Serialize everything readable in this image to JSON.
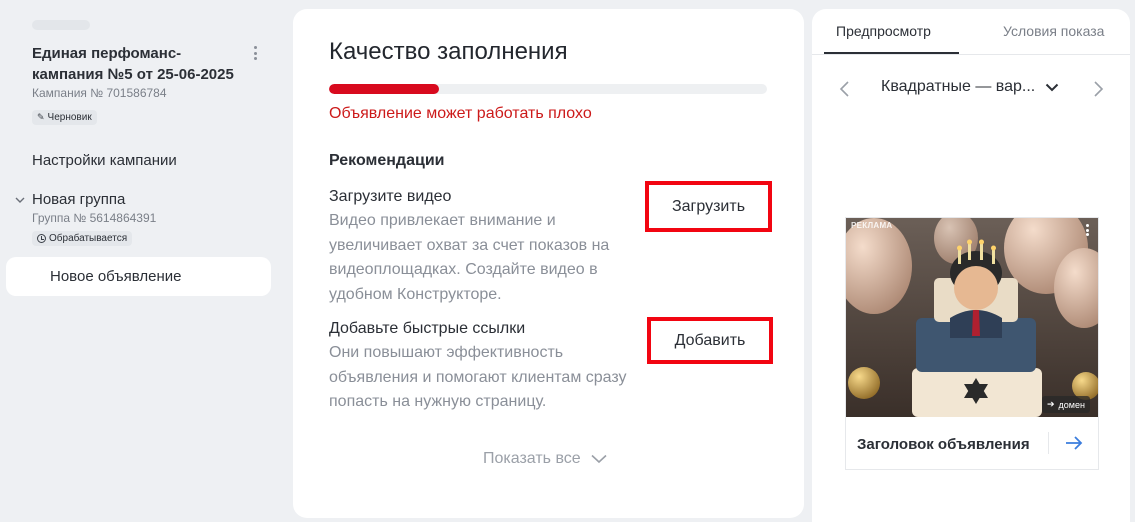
{
  "sidebar": {
    "campaign_title": "Единая перфоманс-кампания №5 от 25-06-2025",
    "campaign_number": "Кампания № 701586784",
    "draft_badge": "Черновик",
    "settings_link": "Настройки кампании",
    "group": {
      "name": "Новая группа",
      "number": "Группа № 5614864391",
      "status_badge": "Обрабатывается"
    },
    "selected_ad": "Новое объявление"
  },
  "quality": {
    "title": "Качество заполнения",
    "progress": 0.25,
    "progress_color": "#d80a1e",
    "warning": "Объявление может работать плохо",
    "recommendations_heading": "Рекомендации",
    "recommendations": [
      {
        "title": "Загрузите видео",
        "description": "Видео привлекает внимание и увеличивает охват за счет показов на видеоплощадках. Создайте видео в удобном Конструкторе.",
        "button": "Загрузить"
      },
      {
        "title": "Добавьте быстрые ссылки",
        "description": "Они повышают эффективность объявления и помогают клиентам сразу попасть на нужную страницу.",
        "button": "Добавить"
      }
    ],
    "show_all": "Показать все"
  },
  "preview": {
    "tabs": [
      "Предпросмотр",
      "Условия показа"
    ],
    "active_tab": "Предпросмотр",
    "format_select": "Квадратные — вар...",
    "ad": {
      "label": "РЕКЛАМА",
      "domain": "домен",
      "headline": "Заголовок объявления"
    }
  },
  "colors": {
    "accent_red": "#f20511",
    "warning_text": "#cc1a1a",
    "link_blue": "#3b7ddd"
  }
}
